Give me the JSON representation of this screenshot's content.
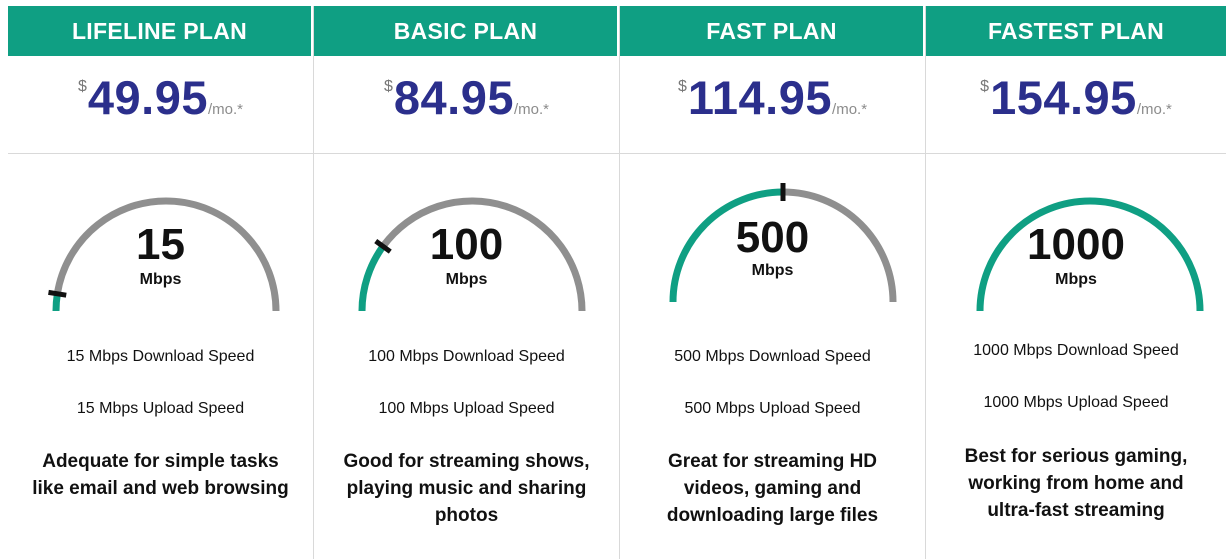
{
  "colors": {
    "header_bg": "#0f9f83",
    "header_text": "#ffffff",
    "price": "#2b2f8c",
    "gauge_fill": "#0f9f83",
    "gauge_track": "#8f8f8f",
    "needle": "#111111"
  },
  "plans": [
    {
      "name": "LIFELINE PLAN",
      "currency": "$",
      "price": "49.95",
      "per": "/mo.*",
      "speed": "15",
      "unit": "Mbps",
      "gauge_fraction": 0.05,
      "download": "15 Mbps Download Speed",
      "upload": "15 Mbps Upload Speed",
      "description": "Adequate for simple tasks like email and web browsing"
    },
    {
      "name": "BASIC PLAN",
      "currency": "$",
      "price": "84.95",
      "per": "/mo.*",
      "speed": "100",
      "unit": "Mbps",
      "gauge_fraction": 0.2,
      "download": "100 Mbps Download Speed",
      "upload": "100 Mbps Upload Speed",
      "description": "Good for streaming shows, playing music and sharing photos"
    },
    {
      "name": "FAST PLAN",
      "currency": "$",
      "price": "114.95",
      "per": "/mo.*",
      "speed": "500",
      "unit": "Mbps",
      "gauge_fraction": 0.5,
      "download": "500 Mbps Download Speed",
      "upload": "500 Mbps Upload Speed",
      "description": "Great for streaming HD videos, gaming and downloading large files"
    },
    {
      "name": "FASTEST PLAN",
      "currency": "$",
      "price": "154.95",
      "per": "/mo.*",
      "speed": "1000",
      "unit": "Mbps",
      "gauge_fraction": 1.0,
      "download": "1000 Mbps Download Speed",
      "upload": "1000 Mbps Upload Speed",
      "description": "Best for serious gaming, working from home and ultra-fast streaming"
    }
  ]
}
